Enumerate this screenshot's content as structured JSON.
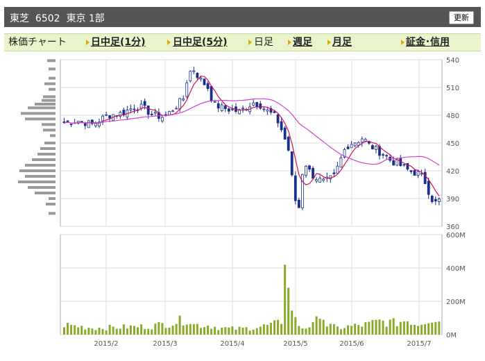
{
  "header": {
    "company": "東芝",
    "code": "6502",
    "market": "東京 1部",
    "refresh_label": "更新"
  },
  "tabs": [
    {
      "label": "株価チャート",
      "active": false
    },
    {
      "label": "日中足(1分)",
      "active": true
    },
    {
      "label": "日中足(5分)",
      "active": true
    },
    {
      "label": "日足",
      "active": false
    },
    {
      "label": "週足",
      "active": true
    },
    {
      "label": "月足",
      "active": true
    },
    {
      "label": "証金･信用",
      "active": true
    }
  ],
  "colors": {
    "up": "#ffffff",
    "down": "#1a2e8c",
    "ma_short": "#cc1155",
    "ma_long": "#cc44cc",
    "volume": "#8aaa2c",
    "histogram": "#999999"
  },
  "chart_data": [
    {
      "type": "candlestick",
      "ylim": [
        360,
        540
      ],
      "yticks": [
        360,
        390,
        420,
        450,
        480,
        510,
        540
      ],
      "x_labels": [
        "2015/2",
        "2015/3",
        "2015/4",
        "2015/5",
        "2015/6",
        "2015/7"
      ],
      "ohlc_samples": [
        {
          "date": "2015/1 end",
          "close": 472
        },
        {
          "date": "2015/2",
          "close": 474
        },
        {
          "date": "2015/3",
          "close": 488
        },
        {
          "date": "2015/3 end",
          "close": 478
        },
        {
          "date": "2015/4 start",
          "close": 527
        },
        {
          "date": "2015/4",
          "close": 487
        },
        {
          "date": "2015/4 end",
          "close": 492
        },
        {
          "date": "2015/5 start",
          "close": 372
        },
        {
          "date": "2015/5",
          "close": 408
        },
        {
          "date": "2015/6 start",
          "close": 450
        },
        {
          "date": "2015/6",
          "close": 430
        },
        {
          "date": "2015/7 start",
          "close": 422
        },
        {
          "date": "2015/7",
          "close": 389
        }
      ],
      "series": [
        {
          "name": "",
          "role": "short moving average"
        },
        {
          "name": "",
          "role": "long moving average"
        }
      ]
    },
    {
      "type": "bar",
      "ylim": [
        0,
        600
      ],
      "yticks": [
        "0M",
        "200M",
        "400M",
        "600M"
      ],
      "x_labels": [
        "2015/2",
        "2015/3",
        "2015/4",
        "2015/5",
        "2015/6",
        "2015/7"
      ],
      "peak_value": 420
    }
  ]
}
